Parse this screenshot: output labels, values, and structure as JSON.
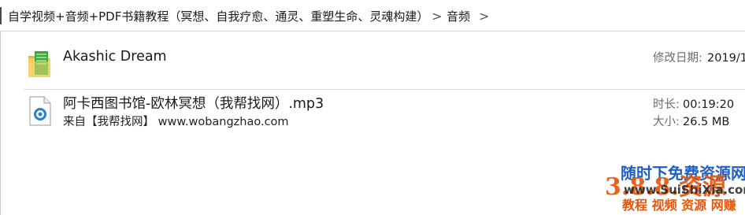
{
  "address_bar": {
    "path_text": "自学视频+音频+PDF书籍教程（冥想、自我疗愈、通灵、重塑生命、灵魂构建）",
    "separator": ">",
    "current_folder": "音频",
    "trailing_separator": ">"
  },
  "items": [
    {
      "icon": "folder-icon",
      "name": "Akashic Dream",
      "meta_label": "修改日期:",
      "meta_value": "2019/1"
    },
    {
      "icon": "audio-file-icon",
      "name": "阿卡西图书馆-欧林冥想（我帮找网）.mp3",
      "subtitle": "来自【我帮找网】 www.wobangzhao.com",
      "duration_label": "时长:",
      "duration_value": "00:19:20",
      "size_label": "大小:",
      "size_value": "26.5 MB"
    }
  ],
  "watermark": {
    "top_text": "随时下免费资源网",
    "logo_text": "3.8.8.资源",
    "domain_text": "www.SuiShiXia.com",
    "bottom_text": "教程 视频 资源 网赚"
  },
  "colors": {
    "folder_green": "#3aa835",
    "audio_blue": "#2a7fd0",
    "divider": "#e1e1e1",
    "meta_label": "#6d6d6d",
    "watermark_blue": "#1f5fc7",
    "watermark_orange": "#e8560c"
  }
}
